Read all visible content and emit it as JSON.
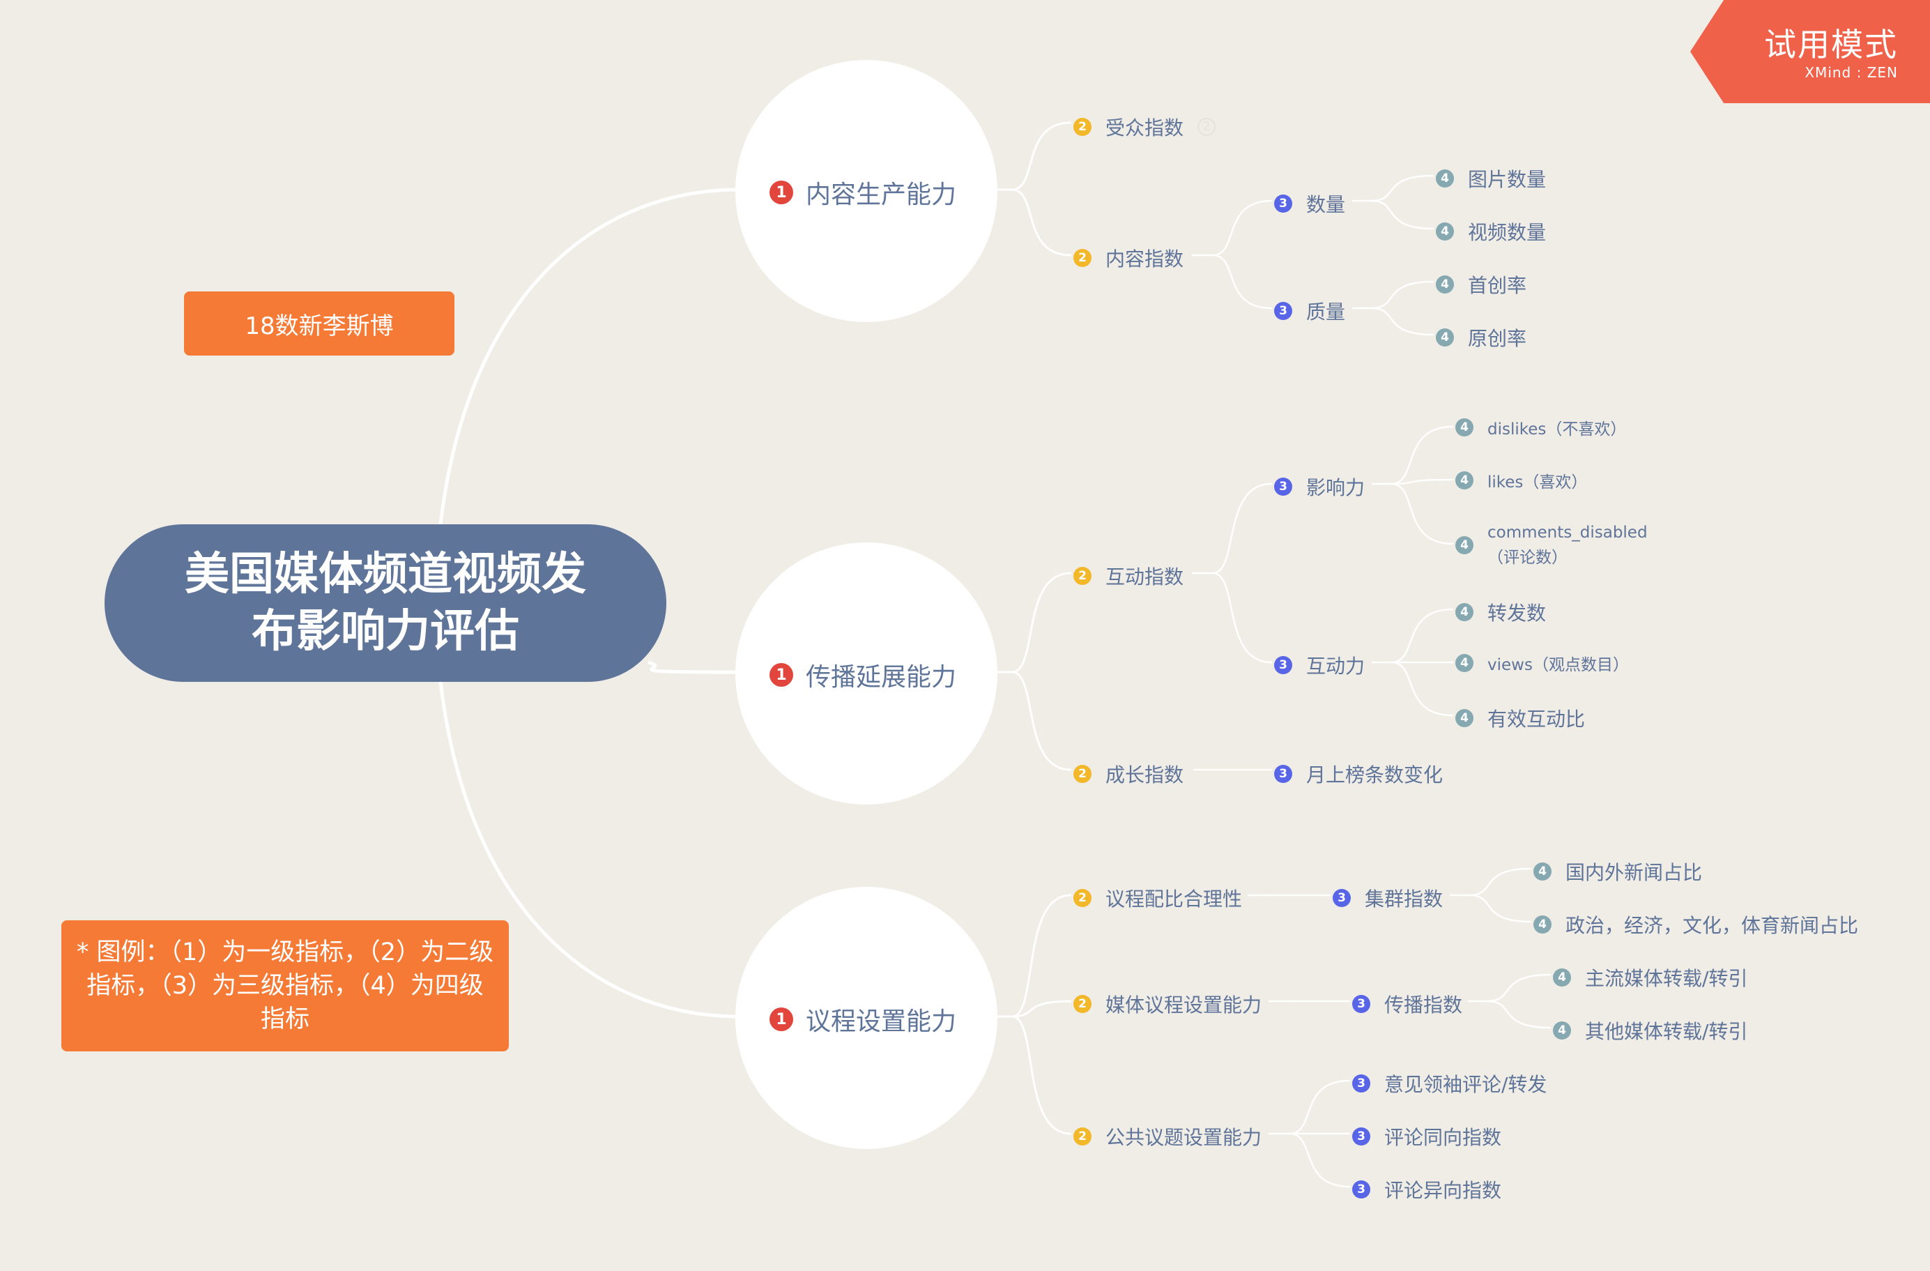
{
  "trial": {
    "title": "试用模式",
    "brand": "XMind : ZEN"
  },
  "root": {
    "title": "美国媒体频道视频发布影响力评估"
  },
  "notes": {
    "author": "18数新李斯博",
    "legend": "* 图例：（1）为一级指标，（2）为二级指标，（3）为三级指标，（4）为四级指标"
  },
  "colors": {
    "root": "#5f7499",
    "level1": "#e2453c",
    "level2": "#f2b82a",
    "level3": "#5765e6",
    "level4": "#86a8b0",
    "sticker": "#f47a36",
    "trial": "#f0614a"
  },
  "branches": [
    {
      "label": "内容生产能力",
      "level": "1",
      "children": [
        {
          "label": "受众指数",
          "level": "2",
          "marker": "2"
        },
        {
          "label": "内容指数",
          "level": "2",
          "children": [
            {
              "label": "数量",
              "level": "3",
              "children": [
                {
                  "label": "图片数量",
                  "level": "4"
                },
                {
                  "label": "视频数量",
                  "level": "4"
                }
              ]
            },
            {
              "label": "质量",
              "level": "3",
              "children": [
                {
                  "label": "首创率",
                  "level": "4"
                },
                {
                  "label": "原创率",
                  "level": "4"
                }
              ]
            }
          ]
        }
      ]
    },
    {
      "label": "传播延展能力",
      "level": "1",
      "children": [
        {
          "label": "互动指数",
          "level": "2",
          "children": [
            {
              "label": "影响力",
              "level": "3",
              "children": [
                {
                  "label": "dislikes（不喜欢）",
                  "level": "4"
                },
                {
                  "label": "likes（喜欢）",
                  "level": "4"
                },
                {
                  "label": "comments_disabled（评论数）",
                  "level": "4"
                }
              ]
            },
            {
              "label": "互动力",
              "level": "3",
              "children": [
                {
                  "label": "转发数",
                  "level": "4"
                },
                {
                  "label": "views（观点数目）",
                  "level": "4"
                },
                {
                  "label": "有效互动比",
                  "level": "4"
                }
              ]
            }
          ]
        },
        {
          "label": "成长指数",
          "level": "2",
          "children": [
            {
              "label": "月上榜条数变化",
              "level": "3"
            }
          ]
        }
      ]
    },
    {
      "label": "议程设置能力",
      "level": "1",
      "children": [
        {
          "label": "议程配比合理性",
          "level": "2",
          "children": [
            {
              "label": "集群指数",
              "level": "3",
              "children": [
                {
                  "label": "国内外新闻占比",
                  "level": "4"
                },
                {
                  "label": "政治，经济，文化，体育新闻占比",
                  "level": "4"
                }
              ]
            }
          ]
        },
        {
          "label": "媒体议程设置能力",
          "level": "2",
          "children": [
            {
              "label": "传播指数",
              "level": "3",
              "children": [
                {
                  "label": "主流媒体转载/转引",
                  "level": "4"
                },
                {
                  "label": "其他媒体转载/转引",
                  "level": "4"
                }
              ]
            }
          ]
        },
        {
          "label": "公共议题设置能力",
          "level": "2",
          "children": [
            {
              "label": "意见领袖评论/转发",
              "level": "3"
            },
            {
              "label": "评论同向指数",
              "level": "3"
            },
            {
              "label": "评论异向指数",
              "level": "3"
            }
          ]
        }
      ]
    }
  ]
}
